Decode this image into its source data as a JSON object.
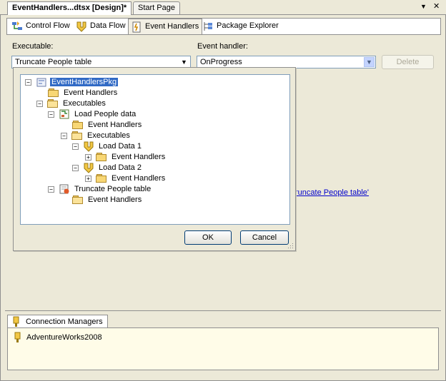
{
  "doc_tabs": {
    "active": "EventHandlers...dtsx [Design]*",
    "inactive": "Start Page",
    "nav_arrow": "▼",
    "close": "✕"
  },
  "designer_tabs": [
    {
      "label": "Control Flow",
      "icon": "control-flow-icon"
    },
    {
      "label": "Data Flow",
      "icon": "data-flow-icon"
    },
    {
      "label": "Event Handlers",
      "icon": "event-handlers-icon",
      "selected": true
    },
    {
      "label": "Package Explorer",
      "icon": "package-explorer-icon"
    }
  ],
  "executable": {
    "label": "Executable:",
    "value": "Truncate People table"
  },
  "event_handler": {
    "label": "Event handler:",
    "value": "OnProgress"
  },
  "delete_button": "Delete",
  "tree": {
    "root": "EventHandlersPkg",
    "root_event_handlers": "Event Handlers",
    "executables": "Executables",
    "load_people": "Load People data",
    "load_people_event_handlers": "Event Handlers",
    "inner_executables": "Executables",
    "load_data_1": "Load Data 1",
    "load_data_1_event_handlers": "Event Handlers",
    "load_data_2": "Load Data 2",
    "load_data_2_event_handlers": "Event Handlers",
    "truncate": "Truncate People table",
    "truncate_event_handlers": "Event Handlers"
  },
  "ok_button": "OK",
  "cancel_button": "Cancel",
  "background_link_fragment": "runcate People table'",
  "connection_managers": {
    "tab_label": "Connection Managers",
    "items": [
      "AdventureWorks2008"
    ]
  }
}
